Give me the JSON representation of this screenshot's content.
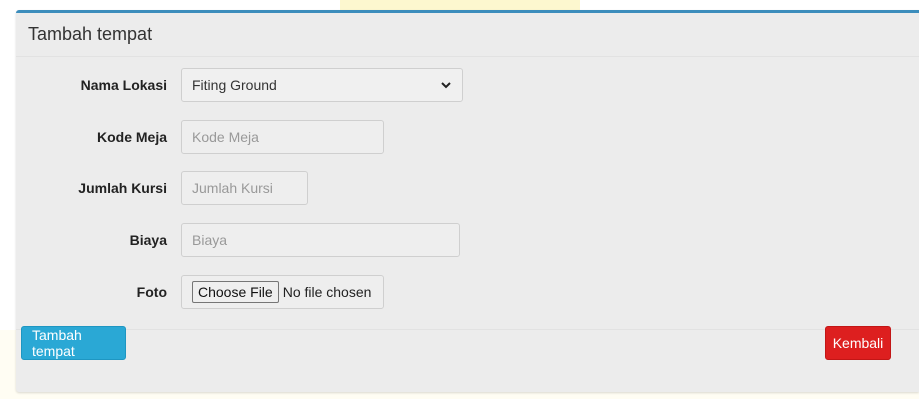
{
  "card": {
    "title": "Tambah tempat"
  },
  "form": {
    "nama_lokasi": {
      "label": "Nama Lokasi",
      "selected": "Fiting Ground"
    },
    "kode_meja": {
      "label": "Kode Meja",
      "placeholder": "Kode Meja"
    },
    "jumlah_kursi": {
      "label": "Jumlah Kursi",
      "placeholder": "Jumlah Kursi"
    },
    "biaya": {
      "label": "Biaya",
      "placeholder": "Biaya"
    },
    "foto": {
      "label": "Foto",
      "button": "Choose File",
      "status": "No file chosen"
    }
  },
  "footer": {
    "submit_label": "Tambah tempat",
    "back_label": "Kembali"
  },
  "colors": {
    "accent": "#3c8dbc",
    "primary": "#2aa8d5",
    "danger": "#dd1f1f"
  }
}
